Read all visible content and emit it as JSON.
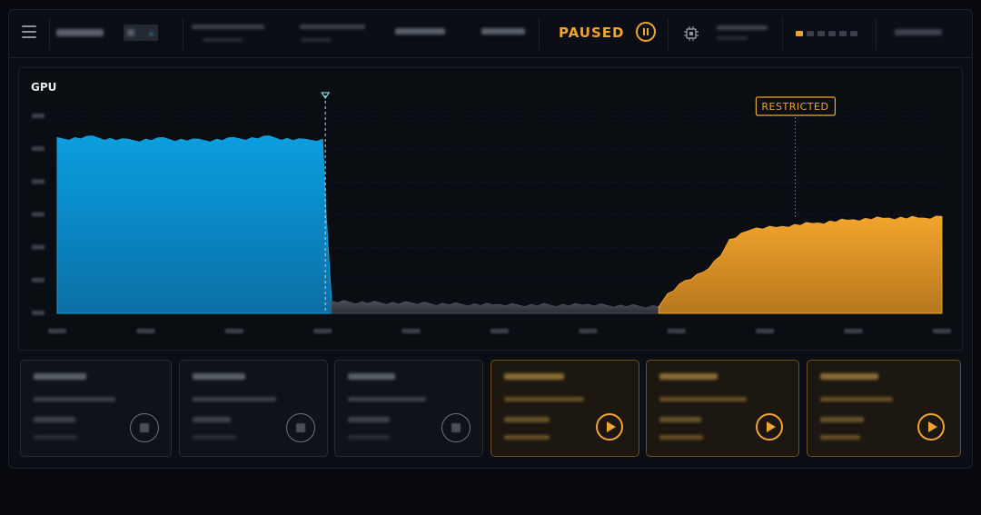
{
  "header": {
    "status_text": "PAUSED",
    "icons": [
      "menu-icon",
      "pause-icon",
      "chip-icon"
    ],
    "page_dots": {
      "count": 6,
      "active_index": 0
    }
  },
  "chart_data": {
    "type": "area",
    "title": "GPU",
    "annotation": "RESTRICTED",
    "y_range": [
      0,
      120
    ],
    "x_range": [
      0,
      100
    ],
    "series": [
      {
        "color": "#0ea0dd",
        "x": [
          0,
          4,
          8,
          12,
          16,
          20,
          24,
          28,
          30,
          30.4,
          31
        ],
        "values": [
          106,
          107,
          105,
          106,
          105,
          106,
          107,
          105,
          106,
          60,
          8
        ]
      },
      {
        "color": "#4a4d53",
        "x": [
          31,
          40,
          50,
          60,
          68
        ],
        "values": [
          7,
          6,
          5,
          5,
          4
        ]
      },
      {
        "color": "#f0a530",
        "x": [
          68,
          69,
          71,
          73,
          75,
          76,
          78,
          79,
          82,
          86,
          90,
          94,
          98,
          100
        ],
        "values": [
          4,
          12,
          20,
          25,
          35,
          45,
          50,
          52,
          53,
          55,
          57,
          58,
          58,
          59
        ]
      }
    ],
    "marker_x": 30,
    "restricted_x": 83,
    "restricted_y": 58,
    "grid_lines": 7,
    "colors": {
      "gpu": "#0ea0dd",
      "idle": "#4a4d53",
      "restricted": "#f0a530"
    }
  },
  "cards": [
    {
      "state": "idle",
      "icon": "thumbnail-icon"
    },
    {
      "state": "idle",
      "icon": "thumbnail-icon"
    },
    {
      "state": "idle",
      "icon": "thumbnail-icon"
    },
    {
      "state": "active",
      "icon": "play-icon"
    },
    {
      "state": "active",
      "icon": "play-icon"
    },
    {
      "state": "active",
      "icon": "play-icon"
    }
  ]
}
